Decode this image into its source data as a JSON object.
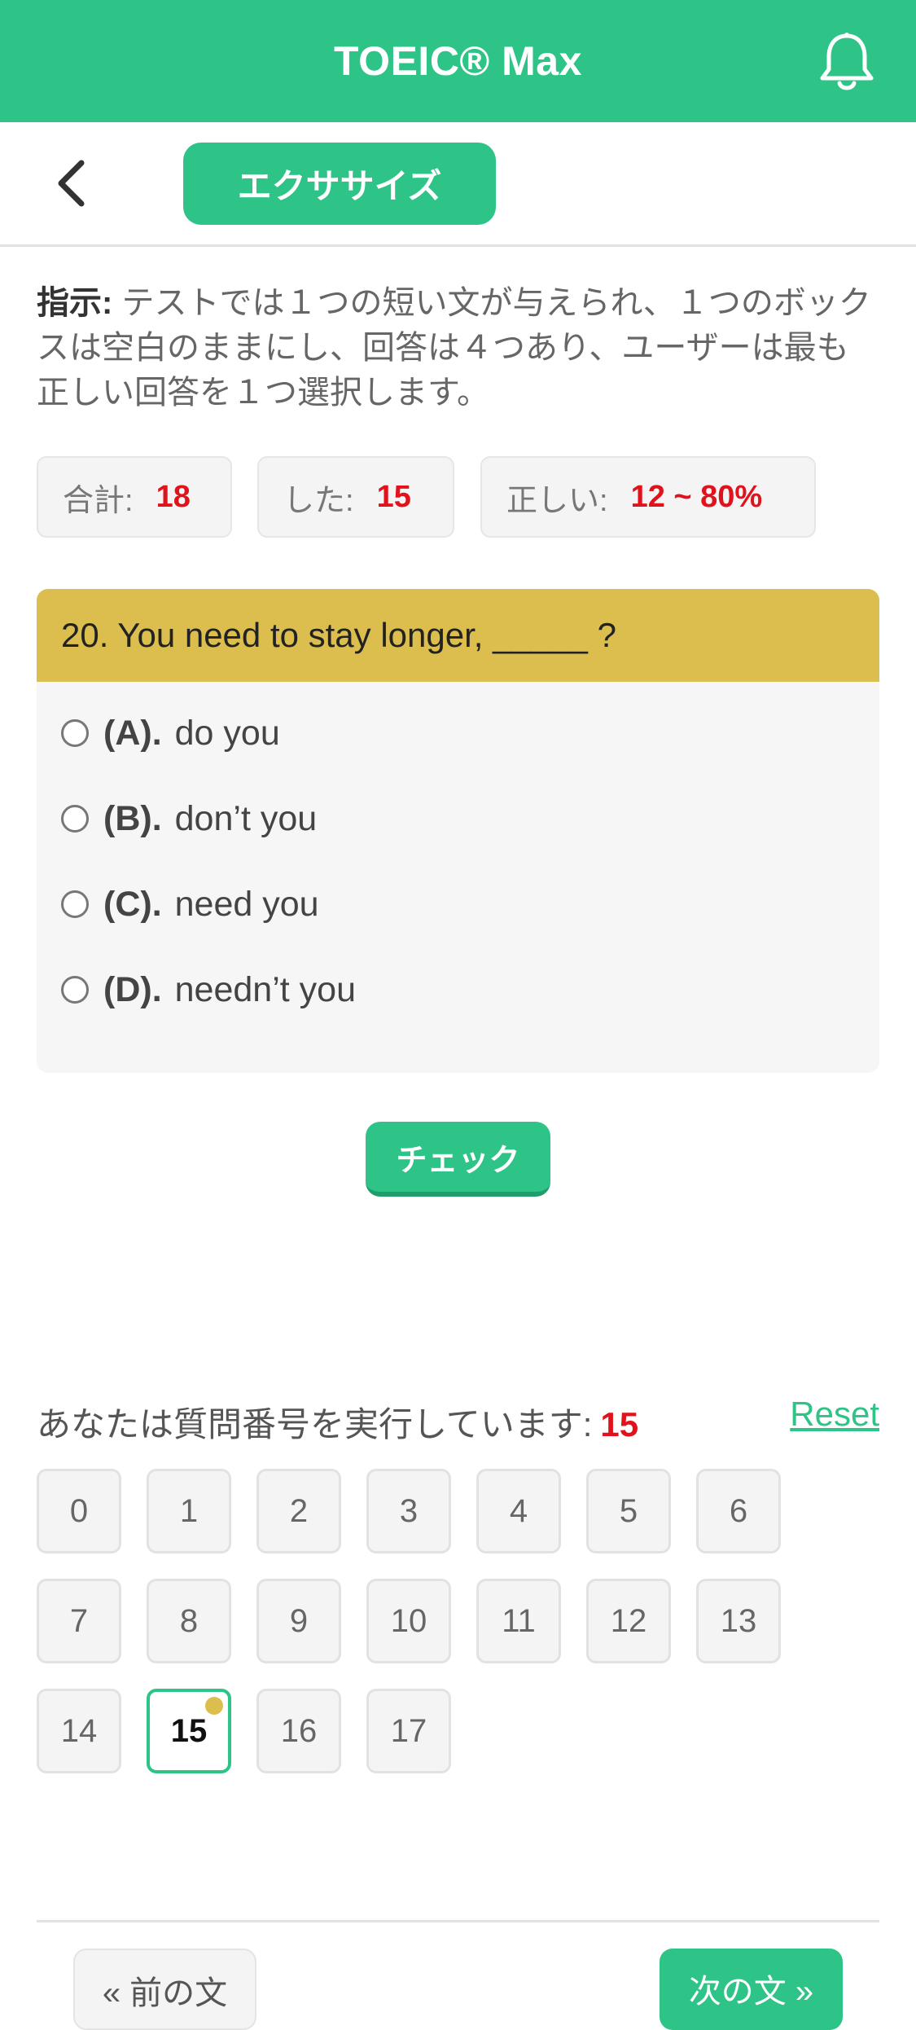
{
  "header": {
    "title": "TOEIC® Max",
    "bell_icon": "bell-icon"
  },
  "subbar": {
    "back_icon": "chevron-left-icon",
    "tab_label": "エクササイズ"
  },
  "instructions": {
    "label": "指示:",
    "text": " テストでは１つの短い文が与えられ、１つのボックスは空白のままにし、回答は４つあり、ユーザーは最も正しい回答を１つ選択します。"
  },
  "stats": [
    {
      "label": "合計:",
      "value": "18"
    },
    {
      "label": "した:",
      "value": "15"
    },
    {
      "label": "正しい:",
      "value": "12 ~ 80%"
    }
  ],
  "question": {
    "text": "20. You need to stay longer, _____ ?",
    "options": [
      {
        "key": "(A).",
        "text": "do you"
      },
      {
        "key": "(B).",
        "text": "don’t you"
      },
      {
        "key": "(C).",
        "text": "need you"
      },
      {
        "key": "(D).",
        "text": "needn’t you"
      }
    ]
  },
  "check_label": "チェック",
  "progress": {
    "label": "あなたは質問番号を実行しています:",
    "current": "15",
    "reset_label": "Reset"
  },
  "question_numbers": [
    "0",
    "1",
    "2",
    "3",
    "4",
    "5",
    "6",
    "7",
    "8",
    "9",
    "10",
    "11",
    "12",
    "13",
    "14",
    "15",
    "16",
    "17"
  ],
  "active_question": "15",
  "nav": {
    "prev_label": "« 前の文",
    "next_label": "次の文 »"
  },
  "colors": {
    "primary": "#2ec487",
    "question_header": "#dbbe4e",
    "highlight": "#e0131d"
  }
}
